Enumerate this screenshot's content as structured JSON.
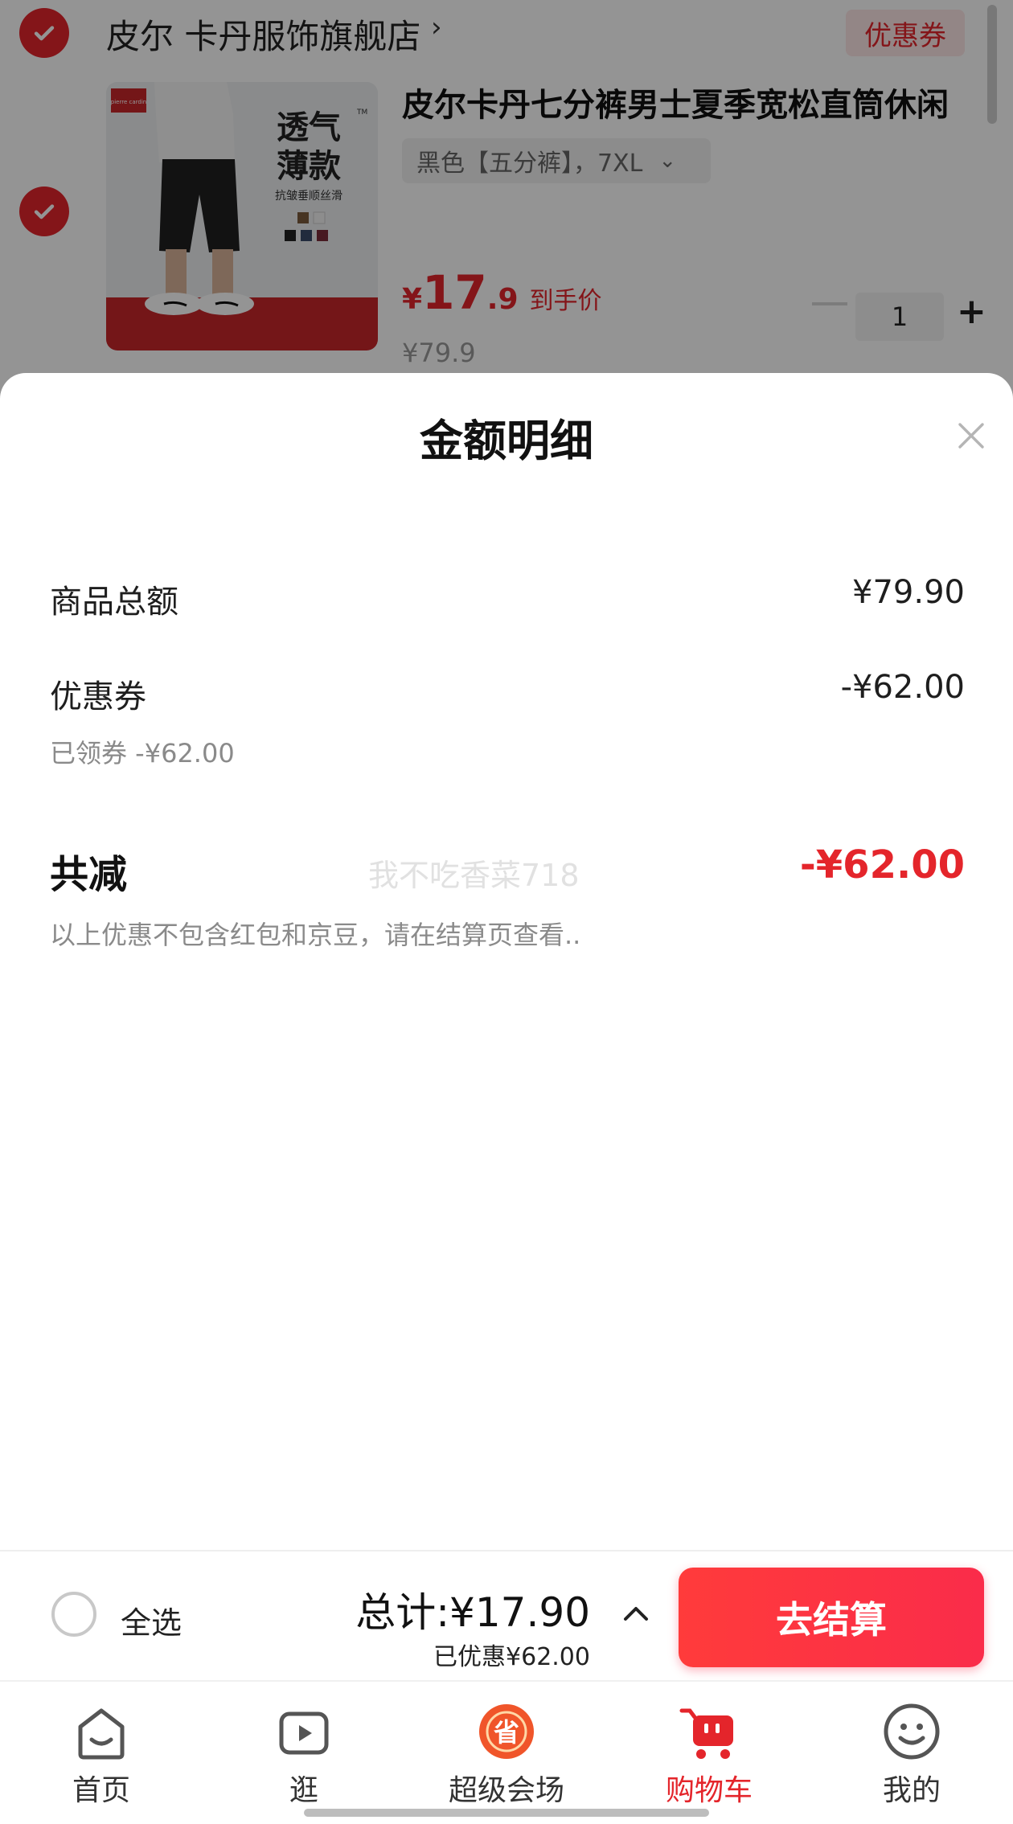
{
  "store": {
    "name": "皮尔 卡丹服饰旗舰店",
    "chevron": "›",
    "coupon_tag": "优惠券"
  },
  "product": {
    "title": "皮尔卡丹七分裤男士夏季宽松直筒休闲",
    "sku": "黑色【五分裤】，7XL",
    "sku_chevron": "⌄",
    "price_yen": "¥",
    "price_int": "17",
    "price_dec": ".9",
    "price_tag": "到手价",
    "original_price": "¥79.9",
    "quantity": "1",
    "image": {
      "brand": "pierre cardin",
      "headline_1": "透气",
      "headline_2": "薄款",
      "subtitle": "抗皱垂顺丝滑",
      "tm": "TM"
    }
  },
  "sheet": {
    "title": "金额明细",
    "rows": [
      {
        "label": "商品总额",
        "value": "¥79.90"
      },
      {
        "label": "优惠券",
        "value": "-¥62.00",
        "note": "已领券 -¥62.00"
      }
    ],
    "total_label": "共减",
    "total_value": "-¥62.00",
    "footnote": "以上优惠不包含红包和京豆，请在结算页查看..",
    "watermark": "我不吃香菜718"
  },
  "checkout": {
    "select_all": "全选",
    "total": "总计:¥17.90",
    "saved": "已优惠¥62.00",
    "button": "去结算"
  },
  "tabs": [
    {
      "label": "首页",
      "icon": "home-icon"
    },
    {
      "label": "逛",
      "icon": "video-play-icon"
    },
    {
      "label": "超级会场",
      "icon": "super-venue-icon"
    },
    {
      "label": "购物车",
      "icon": "shopping-cart-icon",
      "active": true
    },
    {
      "label": "我的",
      "icon": "smiley-profile-icon"
    }
  ],
  "colors": {
    "accent": "#e4252b",
    "checkout_gradient_start": "#ff3b3b",
    "checkout_gradient_end": "#fa2c4a",
    "overlay": "rgba(0,0,0,0.42)"
  }
}
